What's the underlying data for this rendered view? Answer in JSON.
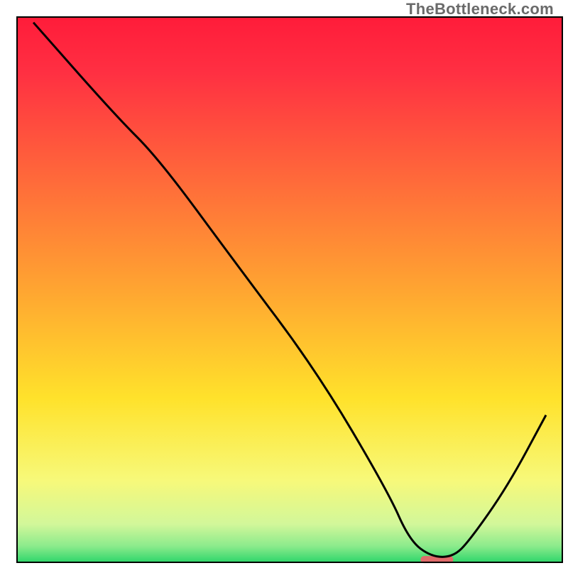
{
  "watermark": "TheBottleneck.com",
  "chart_data": {
    "type": "line",
    "title": "",
    "xlabel": "",
    "ylabel": "",
    "xlim": [
      0,
      100
    ],
    "ylim": [
      0,
      100
    ],
    "note": "No axis ticks, labels, or numeric scale are visible in the image. x/y values below are pixel-space estimates (0-100 normalized to plot area) of the single black curve; the y-axis appears inverted (lower is better / green). Background is a vertical gradient red→orange→yellow→green.",
    "series": [
      {
        "name": "bottleneck-curve",
        "color": "#000000",
        "x": [
          3,
          18,
          26,
          40,
          55,
          68,
          72,
          76,
          80,
          83,
          90,
          97
        ],
        "y": [
          99,
          82,
          74,
          55,
          35,
          13,
          4,
          1,
          1,
          4,
          14,
          27
        ]
      }
    ],
    "marker": {
      "name": "highlight-pill",
      "color": "#e06a6a",
      "x_center": 77,
      "y": 0.5,
      "width": 6
    },
    "gradient_stops": [
      {
        "offset": 0.0,
        "color": "#ff1c3a"
      },
      {
        "offset": 0.1,
        "color": "#ff2f42"
      },
      {
        "offset": 0.3,
        "color": "#ff6a3a"
      },
      {
        "offset": 0.5,
        "color": "#ffa531"
      },
      {
        "offset": 0.7,
        "color": "#ffe22b"
      },
      {
        "offset": 0.85,
        "color": "#f7f97a"
      },
      {
        "offset": 0.93,
        "color": "#d2f79a"
      },
      {
        "offset": 0.97,
        "color": "#8ceb8c"
      },
      {
        "offset": 1.0,
        "color": "#2fd66b"
      }
    ]
  }
}
